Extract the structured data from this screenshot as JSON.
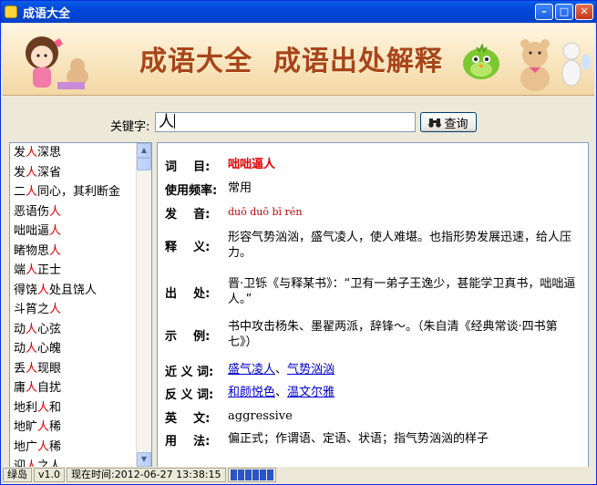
{
  "window": {
    "title": "成语大全"
  },
  "banner": {
    "title": "成语大全  成语出处解释"
  },
  "search": {
    "label": "关键字:",
    "value": "人",
    "button_label": "查询"
  },
  "list": {
    "items": [
      {
        "pre": "发",
        "key": "人",
        "post": "深思"
      },
      {
        "pre": "发",
        "key": "人",
        "post": "深省"
      },
      {
        "pre": "二",
        "key": "人",
        "post": "同心，其利断金"
      },
      {
        "pre": "恶语伤",
        "key": "人",
        "post": ""
      },
      {
        "pre": "咄咄逼",
        "key": "人",
        "post": ""
      },
      {
        "pre": "睹物思",
        "key": "人",
        "post": ""
      },
      {
        "pre": "端",
        "key": "人",
        "post": "正士"
      },
      {
        "pre": "得饶",
        "key": "人",
        "post": "处且饶人"
      },
      {
        "pre": "斗筲之",
        "key": "人",
        "post": ""
      },
      {
        "pre": "动",
        "key": "人",
        "post": "心弦"
      },
      {
        "pre": "动",
        "key": "人",
        "post": "心魄"
      },
      {
        "pre": "丢",
        "key": "人",
        "post": "现眼"
      },
      {
        "pre": "庸",
        "key": "人",
        "post": "自扰"
      },
      {
        "pre": "地利",
        "key": "人",
        "post": "和"
      },
      {
        "pre": "地旷",
        "key": "人",
        "post": "稀"
      },
      {
        "pre": "地广",
        "key": "人",
        "post": "稀"
      },
      {
        "pre": "迎",
        "key": "人",
        "post": "之人"
      }
    ]
  },
  "detail": {
    "word_label": "词    目:",
    "word": "咄咄逼人",
    "freq_label": "使用频率:",
    "freq": "常用",
    "pron_label": "发    音:",
    "pron": "duō duō bī rén",
    "meaning_label": "释    义:",
    "meaning": "形容气势汹汹，盛气凌人，使人难堪。也指形势发展迅速，给人压力。",
    "source_label": "出    处:",
    "source": "晋·卫铄《与释某书》：“卫有一弟子王逸少，甚能学卫真书，咄咄逼人。”",
    "example_label": "示    例:",
    "example": "书中攻击杨朱、墨翟两派，辞锋～。（朱自清《经典常谈·四书第七》）",
    "syn_label": "近 义 词:",
    "synonyms": [
      "盛气凌人",
      "气势汹汹"
    ],
    "syn_sep": "、",
    "ant_label": "反 义 词:",
    "antonyms": [
      "和颜悦色",
      "温文尔雅"
    ],
    "ant_sep": "、",
    "english_label": "英    文:",
    "english": "aggressive",
    "usage_label": "用    法:",
    "usage": "偏正式；作谓语、定语、状语；指气势汹汹的样子"
  },
  "status": {
    "name": "绿岛",
    "version": "v1.0",
    "time": "现在时间:2012-06-27 13:38:15"
  },
  "colors": {
    "highlight": "#e00000",
    "link": "#0000cc",
    "titlebar": "#0047d9"
  }
}
